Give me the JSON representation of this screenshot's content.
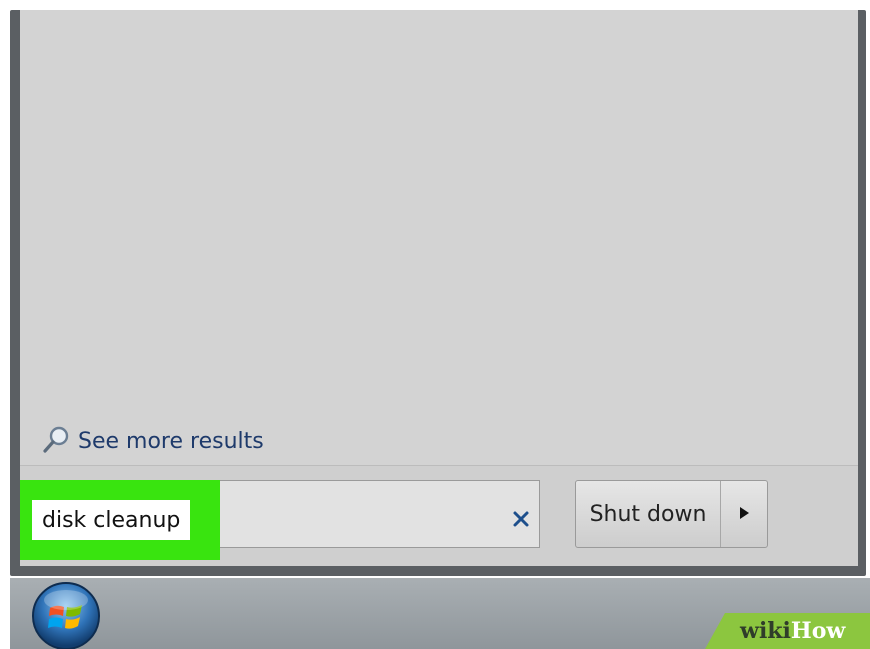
{
  "start_menu": {
    "see_more_label": "See more results",
    "search": {
      "value": "disk cleanup"
    },
    "shutdown": {
      "label": "Shut down"
    }
  },
  "watermark": {
    "wiki": "wiki",
    "how": "How"
  },
  "colors": {
    "highlight": "#39e40f",
    "menu_bg": "#d2d2d2",
    "link": "#1e3a6b"
  },
  "icons": {
    "see_more": "search-icon",
    "clear": "close-icon",
    "arrow": "chevron-right-icon",
    "start": "windows-start-orb-icon"
  }
}
